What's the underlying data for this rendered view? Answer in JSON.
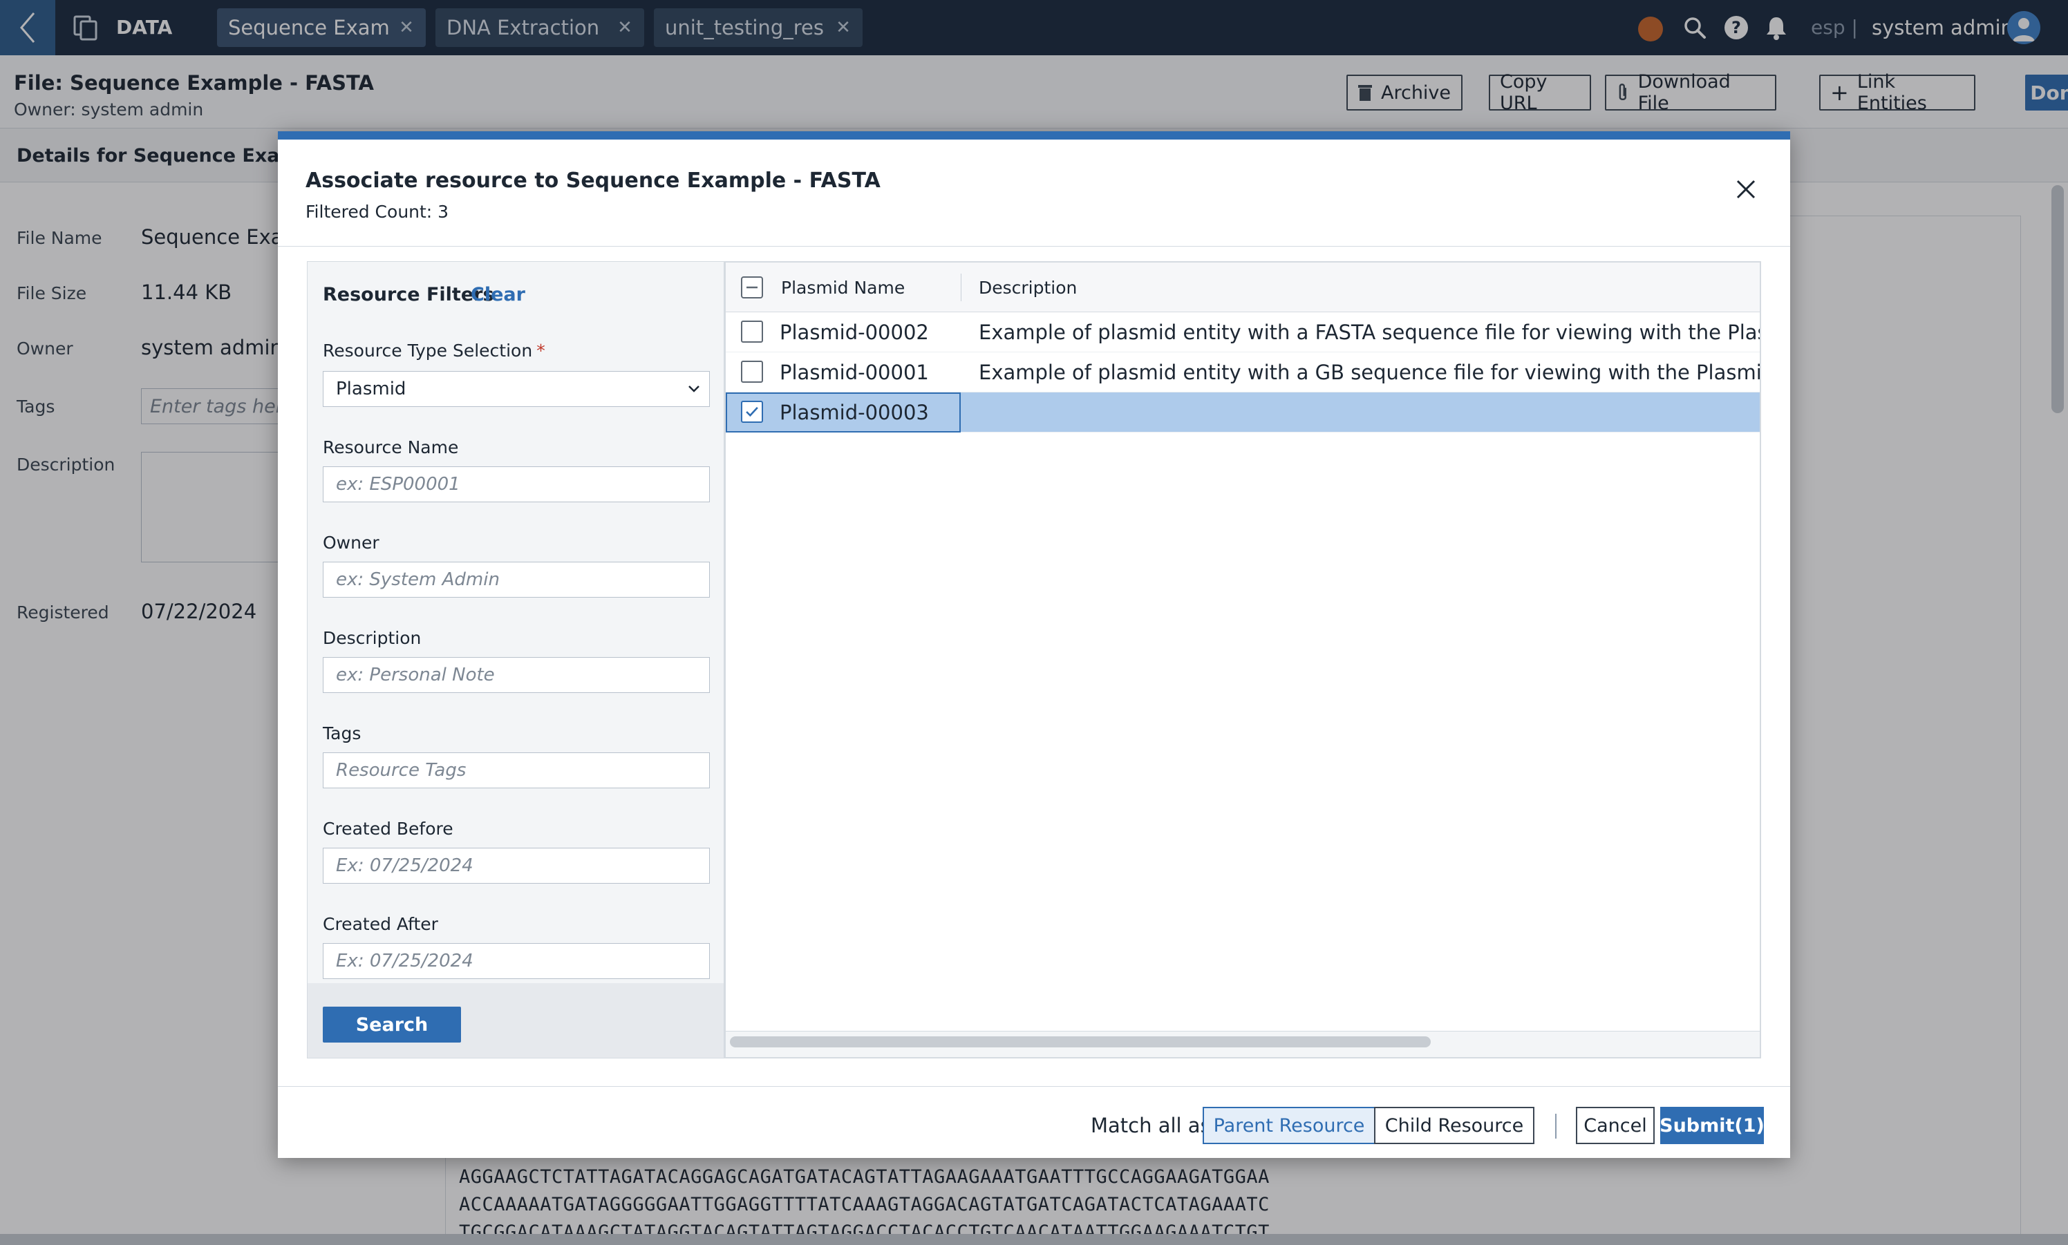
{
  "topbar": {
    "app_label": "DATA",
    "tabs": [
      {
        "label": "Sequence Exam..."
      },
      {
        "label": "DNA Extraction ..."
      },
      {
        "label": "unit_testing_res..."
      }
    ],
    "env": "esp |",
    "user": "system admin",
    "icons": [
      "back-chevron-icon",
      "copy-icon",
      "status-dot",
      "search-icon",
      "help-icon",
      "bell-icon",
      "user-avatar-icon"
    ]
  },
  "header": {
    "title": "File: Sequence Example - FASTA",
    "owner": "Owner: system admin",
    "buttons": {
      "archive": "Archive",
      "copy_url": "Copy URL",
      "download": "Download File",
      "link": "Link Entities",
      "done": "Done"
    }
  },
  "details": {
    "title": "Details for Sequence Example",
    "file_name_label": "File Name",
    "file_name_value": "Sequence Exam",
    "file_size_label": "File Size",
    "file_size_value": "11.44 KB",
    "owner_label": "Owner",
    "owner_value": "system admin",
    "tags_label": "Tags",
    "tags_placeholder": "Enter tags here",
    "description_label": "Description",
    "registered_label": "Registered",
    "registered_value": "07/22/2024"
  },
  "sequence_lines": [
    "AGGAAGCTCTATTAGATACAGGAGCAGATGATACAGTATTAGAAGAAATGAATTTGCCAGGAAGATGGAA",
    "ACCAAAAATGATAGGGGGAATTGGAGGTTTTATCAAAGTAGGACAGTATGATCAGATACTCATAGAAATC",
    "TGCGGACATAAAGCTATAGGTACAGTATTAGTAGGACCTACACCTGTCAACATAATTGGAAGAAATCTGT"
  ],
  "modal": {
    "title": "Associate resource to Sequence Example - FASTA",
    "count": "Filtered Count: 3",
    "filters": {
      "title": "Resource Filters",
      "clear": "Clear",
      "type_label": "Resource Type Selection",
      "type_required": "*",
      "type_value": "Plasmid",
      "name_label": "Resource Name",
      "name_placeholder": "ex: ESP00001",
      "owner_label": "Owner",
      "owner_placeholder": "ex: System Admin",
      "desc_label": "Description",
      "desc_placeholder": "ex: Personal Note",
      "tags_label": "Tags",
      "tags_placeholder": "Resource Tags",
      "before_label": "Created Before",
      "before_placeholder": "Ex: 07/25/2024",
      "after_label": "Created After",
      "after_placeholder": "Ex: 07/25/2024",
      "search": "Search"
    },
    "grid": {
      "col_name": "Plasmid Name",
      "col_desc": "Description",
      "rows": [
        {
          "name": "Plasmid-00002",
          "desc": "Example of plasmid entity with a FASTA sequence file for viewing with the Plasmid Edito",
          "checked": false
        },
        {
          "name": "Plasmid-00001",
          "desc": "Example of plasmid entity with a GB sequence file for viewing with the Plasmid Editor bu",
          "checked": false
        },
        {
          "name": "Plasmid-00003",
          "desc": "",
          "checked": true
        }
      ]
    },
    "footer": {
      "match_label": "Match all as",
      "parent": "Parent Resource",
      "child": "Child Resource",
      "cancel": "Cancel",
      "submit": "Submit(1)"
    }
  },
  "colors": {
    "nav_bg": "#1a2b3f",
    "accent": "#2f6db2",
    "selected_row": "#aecbeb",
    "status_dot": "#c8662b"
  }
}
